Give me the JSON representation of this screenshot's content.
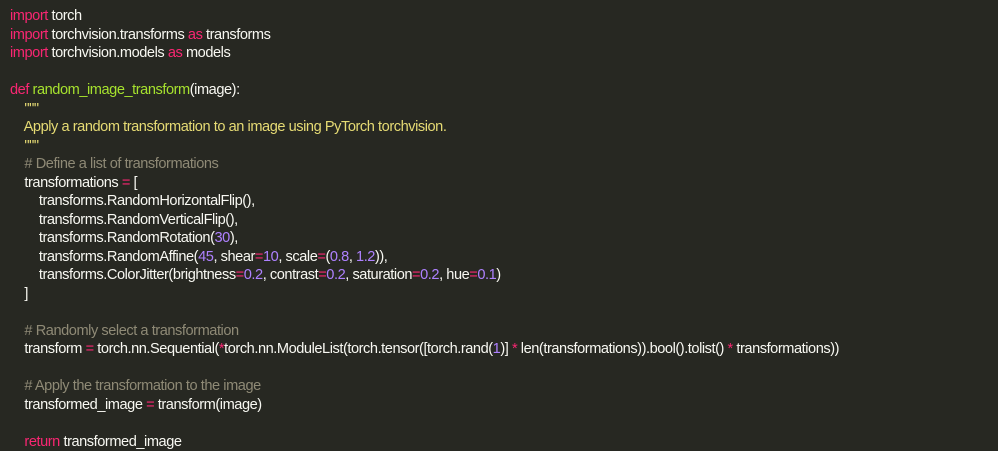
{
  "editor": {
    "background": "#272822",
    "colors": {
      "keyword": "#f92672",
      "function": "#a6e22e",
      "string": "#e6db74",
      "comment": "#8f8a76",
      "number": "#ae81ff",
      "text": "#f8f8f2"
    },
    "lines": [
      [
        [
          "kw",
          "import"
        ],
        [
          "plain",
          " torch"
        ]
      ],
      [
        [
          "kw",
          "import"
        ],
        [
          "plain",
          " torchvision.transforms "
        ],
        [
          "kw",
          "as"
        ],
        [
          "plain",
          " transforms"
        ]
      ],
      [
        [
          "kw",
          "import"
        ],
        [
          "plain",
          " torchvision.models "
        ],
        [
          "kw",
          "as"
        ],
        [
          "plain",
          " models"
        ]
      ],
      [],
      [
        [
          "kw",
          "def"
        ],
        [
          "plain",
          " "
        ],
        [
          "fn",
          "random_image_transform"
        ],
        [
          "plain",
          "(image):"
        ]
      ],
      [
        [
          "str",
          "    \"\"\""
        ]
      ],
      [
        [
          "str",
          "    Apply a random transformation to an image using PyTorch torchvision."
        ]
      ],
      [
        [
          "str",
          "    \"\"\""
        ]
      ],
      [
        [
          "cmt",
          "    # Define a list of transformations"
        ]
      ],
      [
        [
          "plain",
          "    transformations "
        ],
        [
          "op",
          "="
        ],
        [
          "plain",
          " ["
        ]
      ],
      [
        [
          "plain",
          "        transforms.RandomHorizontalFlip(),"
        ]
      ],
      [
        [
          "plain",
          "        transforms.RandomVerticalFlip(),"
        ]
      ],
      [
        [
          "plain",
          "        transforms.RandomRotation("
        ],
        [
          "num",
          "30"
        ],
        [
          "plain",
          "),"
        ]
      ],
      [
        [
          "plain",
          "        transforms.RandomAffine("
        ],
        [
          "num",
          "45"
        ],
        [
          "plain",
          ", shear"
        ],
        [
          "op",
          "="
        ],
        [
          "num",
          "10"
        ],
        [
          "plain",
          ", scale"
        ],
        [
          "op",
          "="
        ],
        [
          "plain",
          "("
        ],
        [
          "num",
          "0.8"
        ],
        [
          "plain",
          ", "
        ],
        [
          "num",
          "1.2"
        ],
        [
          "plain",
          ")),"
        ]
      ],
      [
        [
          "plain",
          "        transforms.ColorJitter(brightness"
        ],
        [
          "op",
          "="
        ],
        [
          "num",
          "0.2"
        ],
        [
          "plain",
          ", contrast"
        ],
        [
          "op",
          "="
        ],
        [
          "num",
          "0.2"
        ],
        [
          "plain",
          ", saturation"
        ],
        [
          "op",
          "="
        ],
        [
          "num",
          "0.2"
        ],
        [
          "plain",
          ", hue"
        ],
        [
          "op",
          "="
        ],
        [
          "num",
          "0.1"
        ],
        [
          "plain",
          ")"
        ]
      ],
      [
        [
          "plain",
          "    ]"
        ]
      ],
      [],
      [
        [
          "cmt",
          "    # Randomly select a transformation"
        ]
      ],
      [
        [
          "plain",
          "    transform "
        ],
        [
          "op",
          "="
        ],
        [
          "plain",
          " torch.nn.Sequential("
        ],
        [
          "op",
          "*"
        ],
        [
          "plain",
          "torch.nn.ModuleList(torch.tensor([torch.rand("
        ],
        [
          "num",
          "1"
        ],
        [
          "plain",
          ")] "
        ],
        [
          "op",
          "*"
        ],
        [
          "plain",
          " len(transformations)).bool().tolist() "
        ],
        [
          "op",
          "*"
        ],
        [
          "plain",
          " transformations))"
        ]
      ],
      [],
      [
        [
          "cmt",
          "    # Apply the transformation to the image"
        ]
      ],
      [
        [
          "plain",
          "    transformed_image "
        ],
        [
          "op",
          "="
        ],
        [
          "plain",
          " transform(image)"
        ]
      ],
      [],
      [
        [
          "plain",
          "    "
        ],
        [
          "kw",
          "return"
        ],
        [
          "plain",
          " transformed_image"
        ]
      ]
    ]
  }
}
